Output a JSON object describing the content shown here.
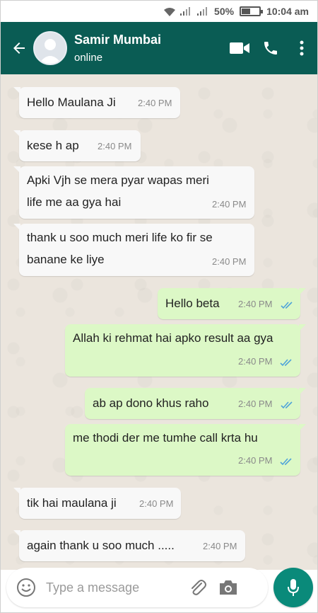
{
  "status_bar": {
    "battery_percent": "50%",
    "battery_level": 0.5,
    "time": "10:04 am",
    "icons": [
      "wifi-icon",
      "signal-icon",
      "signal-icon",
      "battery-icon"
    ]
  },
  "header": {
    "contact_name": "Samir Mumbai",
    "contact_status": "online",
    "icons": [
      "back-arrow-icon",
      "avatar",
      "video-call-icon",
      "phone-call-icon",
      "more-vert-icon"
    ]
  },
  "messages": [
    {
      "direction": "incoming",
      "text": "Hello Maulana Ji",
      "time": "2:40 PM"
    },
    {
      "direction": "incoming",
      "text": "kese h ap",
      "time": "2:40 PM"
    },
    {
      "direction": "incoming",
      "text_lines": [
        "Apki Vjh se mera pyar wapas meri",
        "life me aa gya hai"
      ],
      "time": "2:40 PM"
    },
    {
      "direction": "incoming",
      "text_lines": [
        "thank u soo much meri life ko fir se",
        "banane ke liye"
      ],
      "time": "2:40 PM"
    },
    {
      "direction": "outgoing",
      "text": "Hello beta",
      "time": "2:40 PM",
      "status": "read"
    },
    {
      "direction": "outgoing",
      "text": "Allah ki rehmat hai apko result aa gya",
      "time": "2:40 PM",
      "status": "read"
    },
    {
      "direction": "outgoing",
      "text": "ab ap dono khus raho",
      "time": "2:40 PM",
      "status": "read"
    },
    {
      "direction": "outgoing",
      "text": "me thodi der me tumhe call krta hu",
      "time": "2:40 PM",
      "status": "read"
    },
    {
      "direction": "incoming",
      "text": "tik hai maulana ji",
      "time": "2:40 PM"
    },
    {
      "direction": "incoming",
      "text": "again thank u soo much .....",
      "time": "2:40 PM"
    }
  ],
  "input_bar": {
    "placeholder": "Type a message",
    "icons": [
      "emoji-icon",
      "attach-icon",
      "camera-icon",
      "mic-icon"
    ]
  },
  "colors": {
    "header": "#0a5c54",
    "incoming_bubble": "#f8f8f8",
    "outgoing_bubble": "#dcf8c6",
    "read_ticks": "#4fa3d9",
    "mic_button": "#0a8a7a",
    "chat_background": "#ebe5dd"
  }
}
